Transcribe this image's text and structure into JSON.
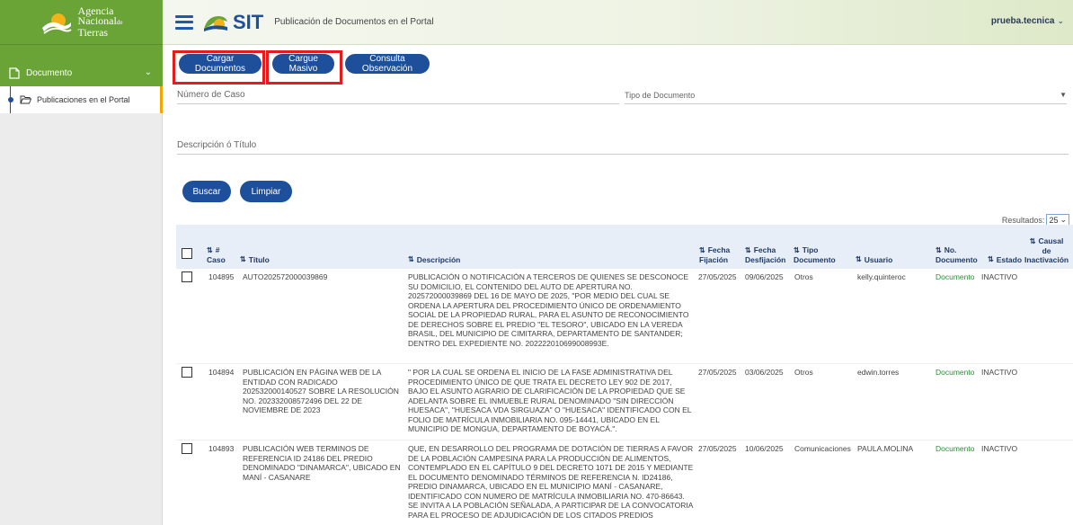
{
  "brand": {
    "line1": "Agencia",
    "line2": "Nacional",
    "line2_suffix": "de",
    "line3": "Tierras"
  },
  "header": {
    "app_name": "SIT",
    "title": "Publicación de Documentos en el Portal",
    "user": "prueba.tecnica",
    "user_caret": "⌄"
  },
  "sidebar": {
    "section_label": "Documento",
    "section_chevron": "⌄",
    "item_label": "Publicaciones en el Portal"
  },
  "actions": {
    "cargar_documentos": "Cargar Documentos",
    "cargue_masivo": "Cargue Masivo",
    "consulta_observacion": "Consulta Observación"
  },
  "filters": {
    "numero_caso": "Número de Caso",
    "tipo_documento": "Tipo de Documento",
    "tipo_documento_caret": "▼",
    "descripcion": "Descripción ó Título",
    "buscar": "Buscar",
    "limpiar": "Limpiar"
  },
  "results": {
    "label": "Resultados:",
    "value": "25",
    "caret": "⌄"
  },
  "table": {
    "sort_icon": "⇅",
    "headers": {
      "caso_1": "#",
      "caso_2": "Caso",
      "titulo": "Título",
      "descripcion": "Descripción",
      "fijacion_1": "Fecha",
      "fijacion_2": "Fijación",
      "desfijacion_1": "Fecha",
      "desfijacion_2": "Desfijación",
      "tipo_1": "Tipo",
      "tipo_2": "Documento",
      "usuario": "Usuario",
      "numdoc_1": "No.",
      "numdoc_2": "Documento",
      "estado": "Estado",
      "causal_1": "Causal",
      "causal_2": "de",
      "causal_3": "Inactivación"
    },
    "rows": [
      {
        "caso": "104895",
        "titulo": "AUTO202572000039869",
        "descripcion": "PUBLICACIÓN O NOTIFICACIÓN A TERCEROS DE QUIENES SE DESCONOCE SU DOMICILIO, EL CONTENIDO DEL AUTO DE APERTURA NO. 202572000039869 DEL 16 DE MAYO DE 2025, \"POR MEDIO DEL CUAL SE ORDENA LA APERTURA DEL PROCEDIMIENTO ÚNICO DE ORDENAMIENTO SOCIAL DE LA PROPIEDAD RURAL, PARA EL ASUNTO DE RECONOCIMIENTO DE DERECHOS SOBRE EL PREDIO \"EL TESORO\", UBICADO EN LA VEREDA BRASIL, DEL MUNICIPIO DE CIMITARRA, DEPARTAMENTO DE SANTANDER; DENTRO DEL EXPEDIENTE NO. 202222010699008993E.",
        "fijacion": "27/05/2025",
        "desfijacion": "09/06/2025",
        "tipo": "Otros",
        "usuario": "kelly.quinteroc",
        "documento": "Documento",
        "estado": "INACTIVO"
      },
      {
        "caso": "104894",
        "titulo": "PUBLICACIÓN EN PÁGINA WEB DE LA ENTIDAD CON RADICADO 202532000140527 SOBRE LA RESOLUCIÓN NO. 202332008572496 DEL 22 DE NOVIEMBRE DE 2023",
        "descripcion": "\" POR LA CUAL SE ORDENA EL INICIO DE LA FASE ADMINISTRATIVA DEL PROCEDIMIENTO ÚNICO DE QUE TRATA EL DECRETO LEY 902 DE 2017, BAJO EL ASUNTO AGRARIO DE CLARIFICACIÓN DE LA PROPIEDAD QUE SE ADELANTA SOBRE EL INMUEBLE RURAL DENOMINADO \"SIN DIRECCIÓN HUESACA\", \"HUESACA VDA SIRGUAZA\" O \"HUESACA\" IDENTIFICADO CON EL FOLIO DE MATRÍCULA INMOBILIARIA NO. 095-14441, UBICADO EN EL MUNICIPIO DE MONGUA, DEPARTAMENTO DE BOYACÁ.\".",
        "fijacion": "27/05/2025",
        "desfijacion": "03/06/2025",
        "tipo": "Otros",
        "usuario": "edwin.torres",
        "documento": "Documento",
        "estado": "INACTIVO"
      },
      {
        "caso": "104893",
        "titulo": "PUBLICACIÓN WEB TERMINOS DE REFERENCIA ID 24186 DEL PREDIO DENOMINADO \"DINAMARCA\", UBICADO EN MANÍ - CASANARE",
        "descripcion": "QUE, EN DESARROLLO DEL PROGRAMA DE DOTACIÓN DE TIERRAS A FAVOR DE LA POBLACIÓN CAMPESINA PARA LA PRODUCCIÓN DE ALIMENTOS, CONTEMPLADO EN EL CAPÍTULO 9 DEL DECRETO 1071 DE 2015 Y MEDIANTE EL DOCUMENTO DENOMINADO TÉRMINOS DE REFERENCIA N. ID24186, PREDIO DINAMARCA, UBICADO EN EL MUNICIPIO MANÍ - CASANARE, IDENTIFICADO CON NUMERO DE MATRÍCULA INMOBILIARIA NO. 470-86643. SE INVITA A LA POBLACIÓN SEÑALADA, A PARTICIPAR DE LA CONVOCATORIA PARA EL PROCESO DE ADJUDICACIÓN DE LOS CITADOS PREDIOS",
        "fijacion": "27/05/2025",
        "desfijacion": "10/06/2025",
        "tipo": "Comunicaciones",
        "usuario": "PAULA.MOLINA",
        "documento": "Documento",
        "estado": "INACTIVO"
      }
    ]
  },
  "colors": {
    "brand_green": "#6aa336",
    "primary_blue": "#1e4f9a",
    "highlight_red": "#e41c1c",
    "link_green": "#2e8b3a",
    "active_item_bar": "#f0a800"
  }
}
